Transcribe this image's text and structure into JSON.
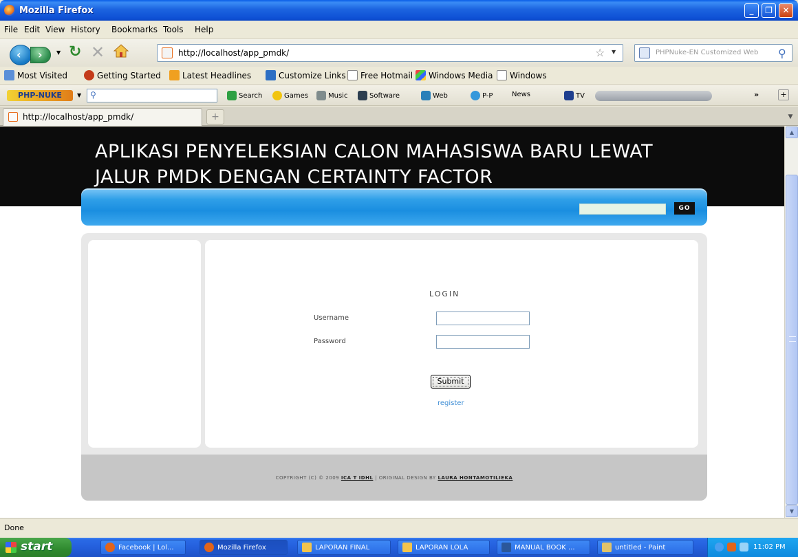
{
  "window": {
    "title": "Mozilla Firefox",
    "minimize": "_",
    "maximize": "❐",
    "close": "✕"
  },
  "menu": [
    "File",
    "Edit",
    "View",
    "History",
    "Bookmarks",
    "Tools",
    "Help"
  ],
  "nav": {
    "url": "http://localhost/app_pmdk/",
    "search_placeholder": "PHPNuke-EN Customized Web"
  },
  "bookmarks": [
    "Most Visited",
    "Getting Started",
    "Latest Headlines",
    "Customize Links",
    "Free Hotmail",
    "Windows Media",
    "Windows"
  ],
  "custom_toolbar": {
    "logo": "PHP-NUKE",
    "items": [
      "Search",
      "Games",
      "Music",
      "Software",
      "Web",
      "P-P",
      "News",
      "TV"
    ]
  },
  "tab": {
    "label": "http://localhost/app_pmdk/",
    "new_tab": "+"
  },
  "page": {
    "title": "APLIKASI PENYELEKSIAN CALON MAHASISWA BARU LEWAT JALUR PMDK DENGAN CERTAINTY FACTOR",
    "search_button": "GO",
    "login_title": "LOGIN",
    "username_label": "Username",
    "password_label": "Password",
    "submit_label": "Submit",
    "register_link": "register",
    "copyright_prefix": "COPYRIGHT (C) © 2009",
    "copyright_owner": "ICA T IDHL",
    "copyright_middle": "| ORIGINAL DESIGN BY",
    "copyright_designer": "LAURA HONTAMOTILIEKA"
  },
  "status": {
    "text": "Done"
  },
  "taskbar": {
    "start": "start",
    "tasks": [
      "Facebook | Lol...",
      "Mozilla Firefox",
      "LAPORAN FINAL",
      "LAPORAN LOLA",
      "MANUAL BOOK ...",
      "untitled - Paint"
    ],
    "clock": "11:02 PM"
  }
}
